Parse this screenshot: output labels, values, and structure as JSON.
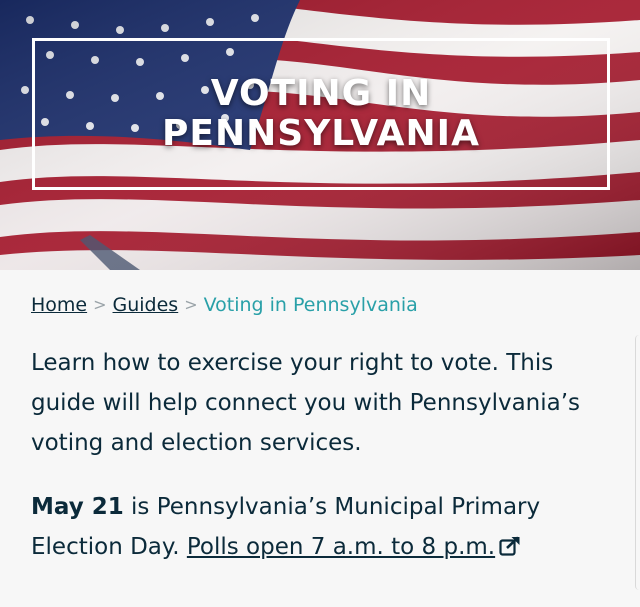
{
  "hero": {
    "title_line1": "VOTING IN",
    "title_line2": "PENNSYLVANIA"
  },
  "breadcrumb": {
    "home": "Home",
    "separator": ">",
    "guides": "Guides",
    "current": "Voting in Pennsylvania"
  },
  "intro": {
    "text": "Learn how to exercise your right to vote. This guide will help connect you with Pennsylvania’s voting and election services."
  },
  "notice": {
    "date": "May 21",
    "text": " is Pennsylvania’s Municipal Primary Election Day. ",
    "link": "Polls open 7 a.m. to 8 p.m.",
    "link_icon": "external-link-icon"
  },
  "colors": {
    "text": "#0b2a3a",
    "breadcrumb_current": "#29a0a8",
    "background": "#f7f7f7"
  }
}
